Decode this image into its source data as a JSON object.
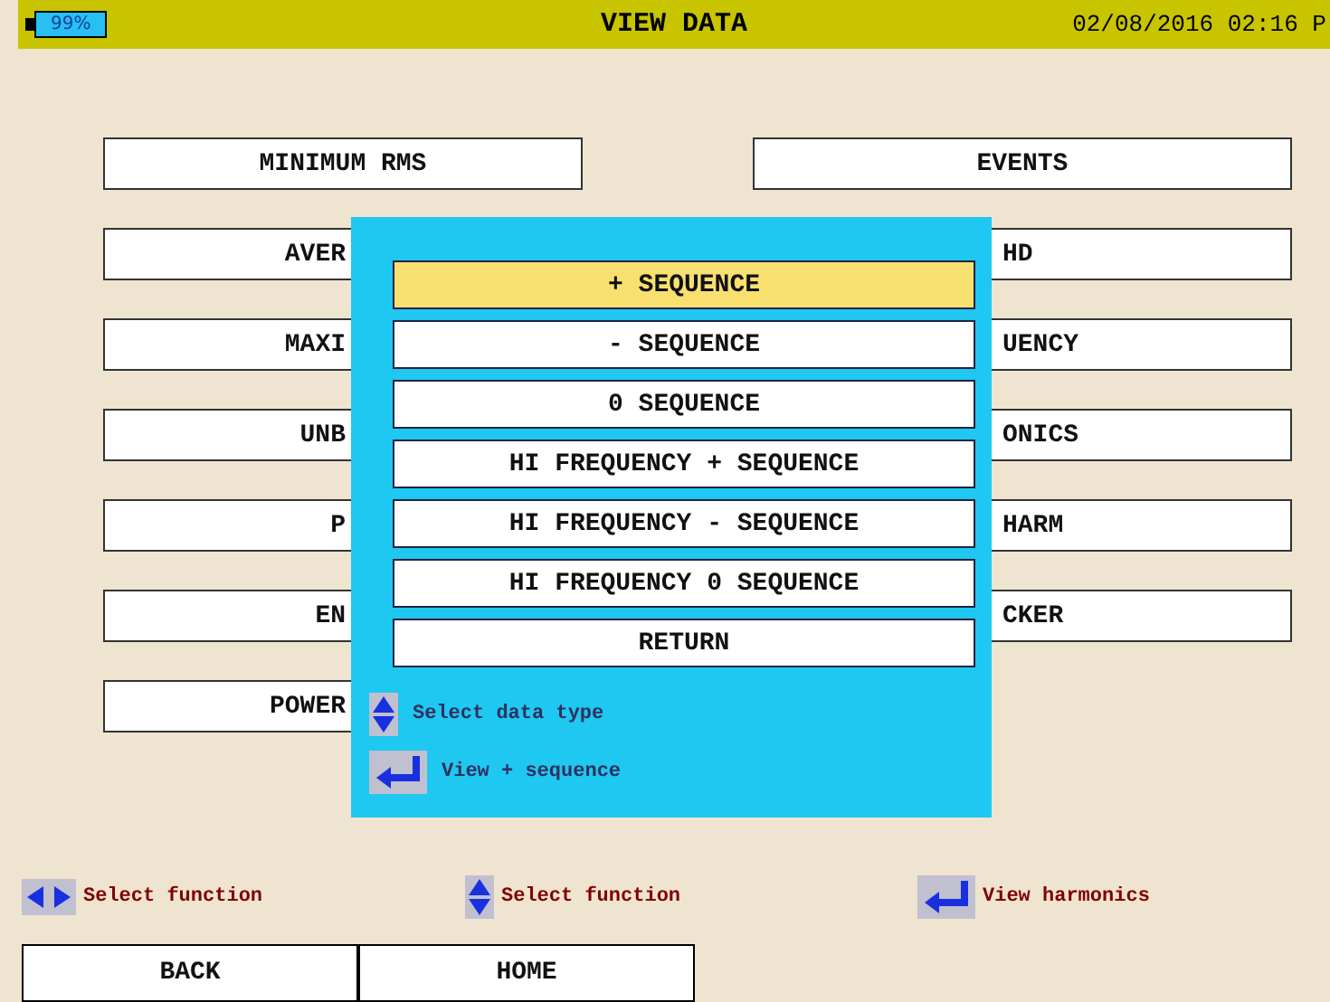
{
  "header": {
    "battery": "99%",
    "title": "VIEW DATA",
    "datetime": "02/08/2016 02:16 P"
  },
  "menu_left": [
    "MINIMUM RMS",
    "AVER",
    "MAXI",
    "UNB",
    "P",
    "EN",
    "POWER"
  ],
  "menu_right": [
    "EVENTS",
    "HD",
    "UENCY",
    "ONICS",
    "HARM",
    "CKER"
  ],
  "popup": {
    "items": [
      {
        "label": "+ SEQUENCE",
        "selected": true
      },
      {
        "label": "- SEQUENCE",
        "selected": false
      },
      {
        "label": "0 SEQUENCE",
        "selected": false
      },
      {
        "label": "HI FREQUENCY + SEQUENCE",
        "selected": false
      },
      {
        "label": "HI FREQUENCY - SEQUENCE",
        "selected": false
      },
      {
        "label": "HI FREQUENCY 0 SEQUENCE",
        "selected": false
      },
      {
        "label": "RETURN",
        "selected": false
      }
    ],
    "hints": [
      {
        "kind": "updown",
        "text": "Select data type"
      },
      {
        "kind": "enter",
        "text": "View + sequence"
      }
    ]
  },
  "hints": [
    {
      "kind": "leftright",
      "text": "Select function"
    },
    {
      "kind": "updown",
      "text": "Select function"
    },
    {
      "kind": "enter",
      "text": "View harmonics"
    }
  ],
  "buttons": [
    "BACK",
    "HOME"
  ]
}
